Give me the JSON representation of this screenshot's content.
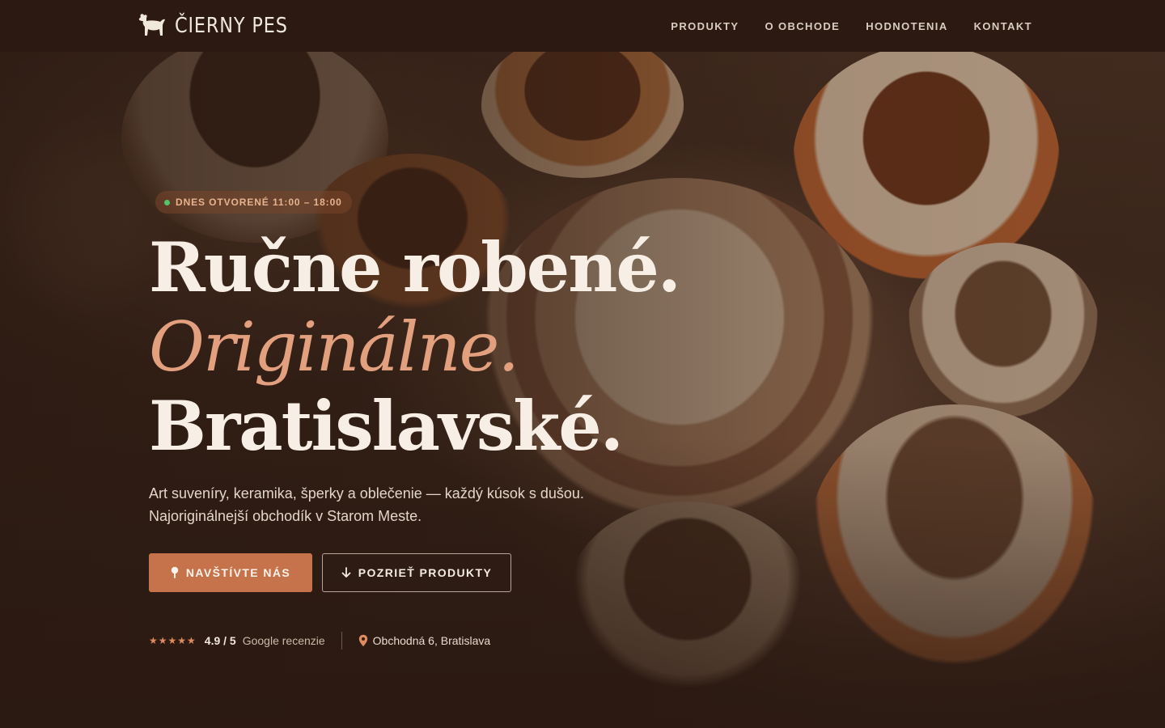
{
  "brand": {
    "name": "ČIERNY PES",
    "logo_icon": "dog-icon"
  },
  "nav": {
    "links": [
      {
        "label": "PRODUKTY"
      },
      {
        "label": "O OBCHODE"
      },
      {
        "label": "HODNOTENIA"
      },
      {
        "label": "KONTAKT"
      }
    ]
  },
  "hero": {
    "badge": {
      "text": "DNES OTVORENÉ 11:00 – 18:00",
      "status_color": "#52c46a"
    },
    "headline": {
      "line1": "Ručne robené.",
      "line2": "Originálne.",
      "line3": "Bratislavské."
    },
    "lede": {
      "line1": "Art suveníry, keramika, šperky a oblečenie — každý kúsok s dušou.",
      "line2": "Najoriginálnejší obchodík v Starom Meste."
    },
    "buttons": {
      "primary": {
        "label": "NAVŠTÍVTE NÁS",
        "icon": "pin-icon"
      },
      "secondary": {
        "label": "POZRIEŤ PRODUKTY",
        "icon": "arrow-down-icon"
      }
    },
    "rating": {
      "stars": "★★★★★",
      "value": "4.9 / 5",
      "label": "Google recenzie"
    },
    "address": {
      "text": "Obchodná 6, Bratislava",
      "icon": "location-pin-icon"
    }
  },
  "colors": {
    "accent": "#c6734c",
    "accent_text": "#e3a07e",
    "background": "#2b1a12"
  }
}
